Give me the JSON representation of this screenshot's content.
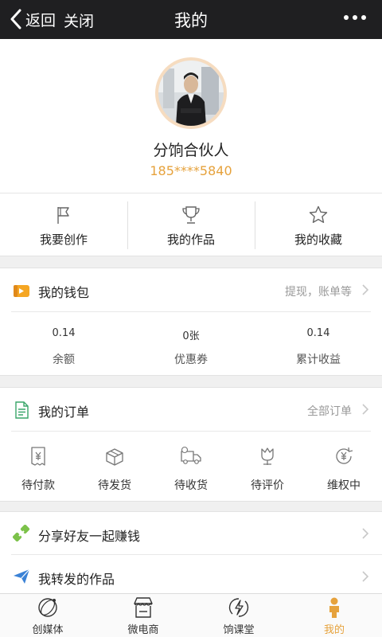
{
  "topbar": {
    "back_label": "返回",
    "close_label": "关闭",
    "title": "我的"
  },
  "profile": {
    "nickname": "分饷合伙人",
    "phone": "185****5840"
  },
  "actions": [
    {
      "label": "我要创作",
      "icon": "flag-icon"
    },
    {
      "label": "我的作品",
      "icon": "trophy-icon"
    },
    {
      "label": "我的收藏",
      "icon": "star-icon"
    }
  ],
  "wallet": {
    "title": "我的钱包",
    "link": "提现，账单等",
    "stats": [
      {
        "value": "0.14",
        "label": "余额"
      },
      {
        "value": "0张",
        "label": "优惠券"
      },
      {
        "value": "0.14",
        "label": "累计收益"
      }
    ]
  },
  "orders": {
    "title": "我的订单",
    "link": "全部订单",
    "items": [
      {
        "label": "待付款",
        "icon": "receipt-icon"
      },
      {
        "label": "待发货",
        "icon": "box-icon"
      },
      {
        "label": "待收货",
        "icon": "truck-icon"
      },
      {
        "label": "待评价",
        "icon": "tulip-icon"
      },
      {
        "label": "维权中",
        "icon": "refund-icon"
      }
    ]
  },
  "list": [
    {
      "label": "分享好友一起赚钱",
      "icon": "link-icon"
    },
    {
      "label": "我转发的作品",
      "icon": "paper-plane-icon"
    }
  ],
  "tabs": [
    {
      "label": "创媒体",
      "icon": "orbit-icon"
    },
    {
      "label": "微电商",
      "icon": "shop-icon"
    },
    {
      "label": "饷课堂",
      "icon": "lightning-icon"
    },
    {
      "label": "我的",
      "icon": "person-icon",
      "active": true
    }
  ],
  "colors": {
    "topbar": "#1f1f21",
    "accent": "#e6a23c",
    "background": "#f0f0f0"
  }
}
